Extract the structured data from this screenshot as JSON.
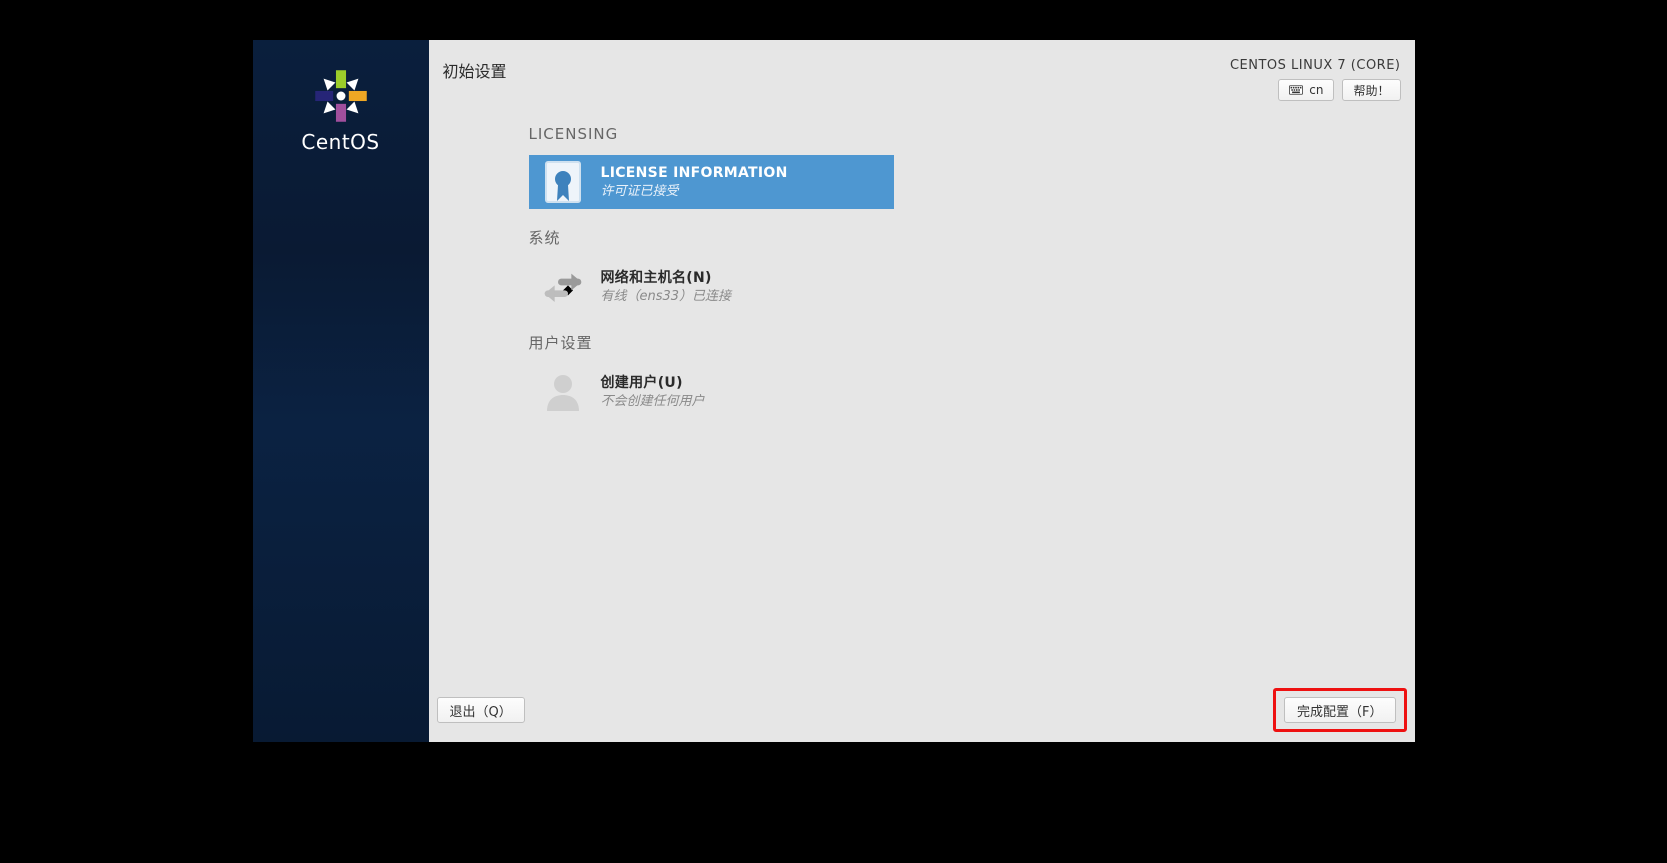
{
  "sidebar": {
    "brand": "CentOS"
  },
  "header": {
    "title": "初始设置",
    "os_label": "CENTOS LINUX 7 (CORE)",
    "keyboard_layout": "cn",
    "help_label": "帮助！"
  },
  "sections": {
    "licensing": {
      "heading": "LICENSING",
      "item": {
        "title": "LICENSE INFORMATION",
        "status": "许可证已接受"
      }
    },
    "system": {
      "heading": "系统",
      "item": {
        "title": "网络和主机名(N)",
        "status": "有线（ens33）已连接"
      }
    },
    "user": {
      "heading": "用户设置",
      "item": {
        "title": "创建用户(U)",
        "status": "不会创建任何用户"
      }
    }
  },
  "footer": {
    "quit_label": "退出（Q）",
    "finish_label": "完成配置（F）"
  }
}
